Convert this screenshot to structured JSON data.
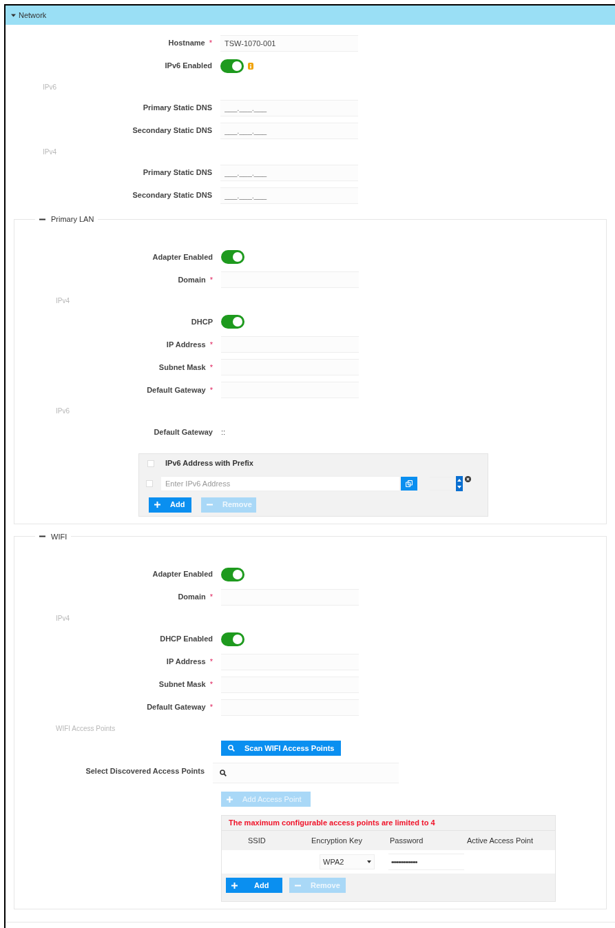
{
  "network": {
    "title": "Network",
    "expanded": true,
    "rows": [
      {
        "kind": "field",
        "label": "Hostname",
        "required_mark": "*",
        "value": "TSW-1070-001"
      },
      {
        "kind": "toggle",
        "label": "IPv6 Enabled",
        "on": true,
        "info": true
      },
      {
        "kind": "group",
        "label": "IPv6"
      },
      {
        "kind": "field",
        "label": "Primary Static DNS",
        "placeholder": "___.___.___"
      },
      {
        "kind": "field",
        "label": "Secondary Static DNS",
        "placeholder": "___.___.___"
      },
      {
        "kind": "group",
        "label": "IPv4"
      },
      {
        "kind": "field",
        "label": "Primary Static DNS",
        "placeholder": "___.___.___"
      },
      {
        "kind": "field",
        "label": "Secondary Static DNS",
        "placeholder": "___.___.___"
      }
    ]
  },
  "primary_lan": {
    "title": "Primary LAN",
    "expanded": true,
    "rows": [
      {
        "kind": "toggle",
        "label": "Adapter Enabled",
        "on": true
      },
      {
        "kind": "field",
        "label": "Domain",
        "required_mark": "*"
      },
      {
        "kind": "group",
        "label": "IPv4"
      },
      {
        "kind": "toggle",
        "label": "DHCP",
        "on": true
      },
      {
        "kind": "field",
        "label": "IP Address",
        "required_mark": "*"
      },
      {
        "kind": "field",
        "label": "Subnet Mask",
        "required_mark": "*"
      },
      {
        "kind": "field",
        "label": "Default Gateway",
        "required_mark": "*"
      },
      {
        "kind": "group",
        "label": "IPv6"
      },
      {
        "kind": "value",
        "label": "Default Gateway",
        "value": "::"
      }
    ],
    "ipv6_table": {
      "header_checked": false,
      "row_checked": false,
      "header": "IPv6 Address with Prefix",
      "placeholder": "Enter IPv6 Address",
      "add": "Add",
      "remove": "Remove",
      "remove_disabled": true
    }
  },
  "wifi": {
    "title": "WIFI",
    "expanded": true,
    "rows": [
      {
        "kind": "toggle",
        "label": "Adapter Enabled",
        "on": true
      },
      {
        "kind": "field",
        "label": "Domain",
        "required_mark": "*"
      },
      {
        "kind": "group",
        "label": "IPv4"
      },
      {
        "kind": "toggle",
        "label": "DHCP Enabled",
        "on": true
      },
      {
        "kind": "field",
        "label": "IP Address",
        "required_mark": "*"
      },
      {
        "kind": "field",
        "label": "Subnet Mask",
        "required_mark": "*"
      },
      {
        "kind": "field",
        "label": "Default Gateway",
        "required_mark": "*"
      },
      {
        "kind": "group",
        "label": "WIFI Access Points"
      }
    ],
    "scan_button": "Scan WIFI Access Points",
    "select_label": "Select Discovered Access Points",
    "add_access_point": {
      "label": "Add Access Point",
      "disabled": true
    },
    "warning": "The maximum configurable access points are limited to 4",
    "columns": [
      "SSID",
      "Encryption Key",
      "Password",
      "Active Access Point"
    ],
    "rows_data": [
      {
        "encryption": "WPA2",
        "password": "•••••••••••••••"
      }
    ],
    "add": "Add",
    "remove": "Remove",
    "remove_disabled": true
  }
}
